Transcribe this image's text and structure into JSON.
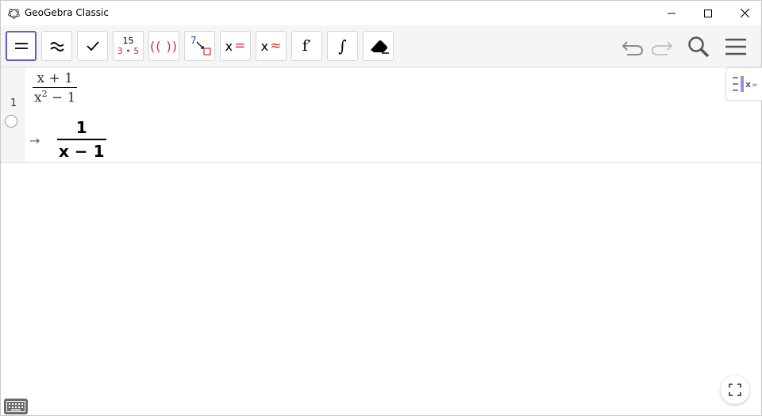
{
  "window": {
    "title": "GeoGebra Classic",
    "icon": "geogebra-logo-icon"
  },
  "toolbar": {
    "tools": [
      {
        "name": "evaluate-tool",
        "icon": "equals-icon"
      },
      {
        "name": "numeric-tool",
        "icon": "approx-icon"
      },
      {
        "name": "keep-input-tool",
        "icon": "checkmark-icon"
      },
      {
        "name": "factor-tool",
        "top": "15",
        "bottom": "3 • 5"
      },
      {
        "name": "expand-tool",
        "label": "(( ))"
      },
      {
        "name": "substitute-tool",
        "label": "7"
      },
      {
        "name": "solve-tool",
        "x": "x",
        "op": "="
      },
      {
        "name": "solve-numerically-tool",
        "x": "x",
        "op": "≈"
      },
      {
        "name": "derivative-tool",
        "label": "f′"
      },
      {
        "name": "integral-tool",
        "label": "∫"
      },
      {
        "name": "delete-tool",
        "icon": "eraser-icon"
      }
    ],
    "accent": "#6557d2",
    "red": "#d32f2f"
  },
  "cas": {
    "rows": [
      {
        "number": "1",
        "input": {
          "numerator": "x + 1",
          "denominator_base": "x",
          "denominator_exp": "2",
          "denominator_rest": " − 1"
        },
        "arrow": "→",
        "output": {
          "numerator": "1",
          "denominator": "x − 1"
        }
      }
    ]
  }
}
